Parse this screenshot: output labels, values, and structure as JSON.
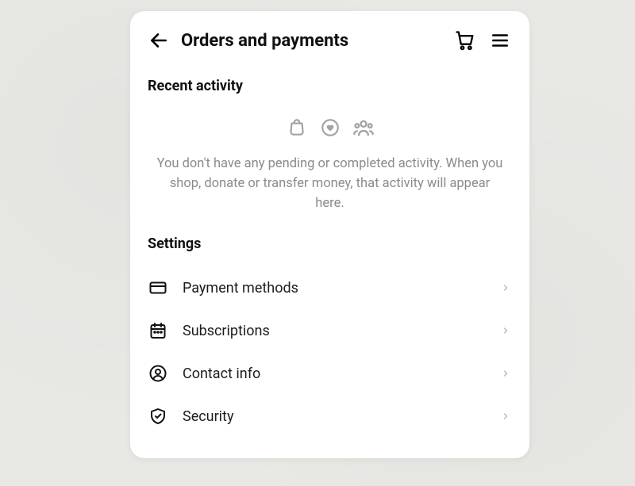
{
  "header": {
    "title": "Orders and payments"
  },
  "section_recent": {
    "title": "Recent activity",
    "empty_text": "You don't have any pending or completed activity. When you shop, donate or transfer money, that activity will appear here."
  },
  "section_settings": {
    "title": "Settings",
    "items": [
      {
        "label": "Payment methods"
      },
      {
        "label": "Subscriptions"
      },
      {
        "label": "Contact info"
      },
      {
        "label": "Security"
      }
    ]
  }
}
